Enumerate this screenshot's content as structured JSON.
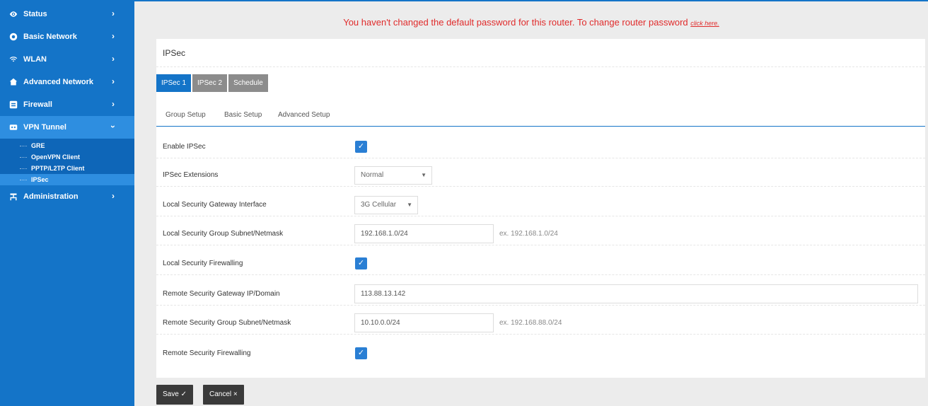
{
  "sidebar": {
    "items": [
      {
        "label": "Status",
        "icon": "eye-icon"
      },
      {
        "label": "Basic Network",
        "icon": "globe-icon"
      },
      {
        "label": "WLAN",
        "icon": "wifi-icon"
      },
      {
        "label": "Advanced Network",
        "icon": "home-icon"
      },
      {
        "label": "Firewall",
        "icon": "firewall-icon"
      },
      {
        "label": "VPN Tunnel",
        "icon": "vpn-icon"
      },
      {
        "label": "Administration",
        "icon": "admin-icon"
      }
    ],
    "vpn_sub": [
      {
        "label": "GRE"
      },
      {
        "label": "OpenVPN Client"
      },
      {
        "label": "PPTP/L2TP Client"
      },
      {
        "label": "IPSec"
      }
    ]
  },
  "alert": {
    "message": "You haven't changed the default password for this router. To change router password",
    "link": "click here."
  },
  "panel": {
    "title": "IPSec",
    "tabs": [
      {
        "label": "IPSec 1"
      },
      {
        "label": "IPSec 2"
      },
      {
        "label": "Schedule"
      }
    ],
    "subtabs": [
      {
        "label": "Group Setup"
      },
      {
        "label": "Basic Setup"
      },
      {
        "label": "Advanced Setup"
      }
    ]
  },
  "form": {
    "enable_ipsec": {
      "label": "Enable IPSec",
      "checked": true
    },
    "ipsec_extensions": {
      "label": "IPSec Extensions",
      "value": "Normal"
    },
    "local_gateway_interface": {
      "label": "Local Security Gateway Interface",
      "value": "3G Cellular"
    },
    "local_group_subnet": {
      "label": "Local Security Group Subnet/Netmask",
      "value": "192.168.1.0/24",
      "hint": "ex. 192.168.1.0/24"
    },
    "local_firewalling": {
      "label": "Local Security Firewalling",
      "checked": true
    },
    "remote_gateway": {
      "label": "Remote Security Gateway IP/Domain",
      "value": "113.88.13.142"
    },
    "remote_group_subnet": {
      "label": "Remote Security Group Subnet/Netmask",
      "value": "10.10.0.0/24",
      "hint": "ex. 192.168.88.0/24"
    },
    "remote_firewalling": {
      "label": "Remote Security Firewalling",
      "checked": true
    }
  },
  "buttons": {
    "save": "Save ✓",
    "cancel": "Cancel ×"
  },
  "colors": {
    "sidebar": "#1474c8",
    "accent": "#2a7fd4",
    "alert": "#e02b2b",
    "button": "#3a3a3a"
  }
}
